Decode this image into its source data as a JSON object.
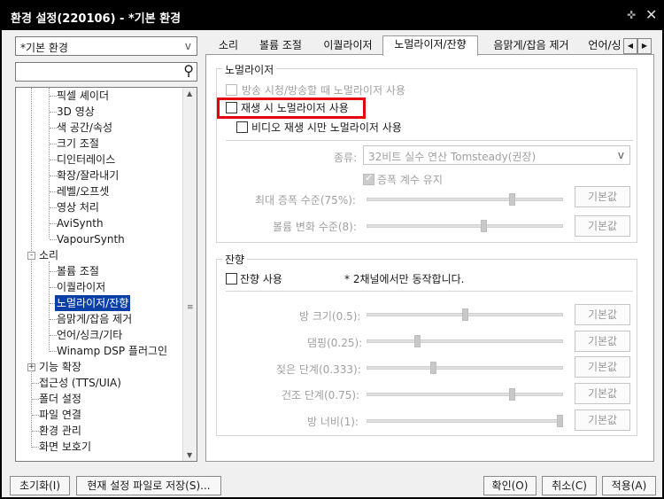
{
  "window": {
    "title": "환경 설정(220106) - *기본 환경",
    "pin_icon": "pin-icon",
    "close_icon": "close-icon"
  },
  "preset": {
    "value": "*기본 환경",
    "arrow": "v"
  },
  "search": {
    "value": "",
    "icon": "search-icon"
  },
  "tree": {
    "items": [
      {
        "label": "픽셀 셰이더"
      },
      {
        "label": "3D 영상"
      },
      {
        "label": "색 공간/속성"
      },
      {
        "label": "크기 조절"
      },
      {
        "label": "디인터레이스"
      },
      {
        "label": "확장/잘라내기"
      },
      {
        "label": "레벨/오프셋"
      },
      {
        "label": "영상 처리"
      },
      {
        "label": "AviSynth"
      },
      {
        "label": "VapourSynth"
      },
      {
        "label": "소리"
      },
      {
        "label": "볼륨 조절"
      },
      {
        "label": "이퀄라이저"
      },
      {
        "label": "노멀라이저/잔향"
      },
      {
        "label": "음맑게/잡음 제거"
      },
      {
        "label": "언어/싱크/기타"
      },
      {
        "label": "Winamp DSP 플러그인"
      },
      {
        "label": "기능 확장"
      },
      {
        "label": "접근성 (TTS/UIA)"
      },
      {
        "label": "폴더 설정"
      },
      {
        "label": "파일 연결"
      },
      {
        "label": "환경 관리"
      },
      {
        "label": "화면 보호기"
      }
    ],
    "expander_minus": "-",
    "expander_plus": "+"
  },
  "tabs": [
    {
      "label": "소리"
    },
    {
      "label": "볼륨 조절"
    },
    {
      "label": "이퀄라이저"
    },
    {
      "label": "노멀라이저/잔향"
    },
    {
      "label": "음맑게/잡음 제거"
    },
    {
      "label": "언어/싱"
    }
  ],
  "tab_nav": {
    "prev": "◀",
    "next": "▶"
  },
  "normalizer": {
    "title": "노멀라이저",
    "opt_broadcast": "방송 시청/방송할 때 노멀라이저 사용",
    "opt_playback": "재생 시 노멀라이저 사용",
    "opt_video": "비디오 재생 시만 노멀라이저 사용",
    "type_label": "종류:",
    "type_value": "32비트 실수 연산 Tomsteady(권장)",
    "type_arrow": "v",
    "keep_gain": "증폭 계수 유지",
    "max_gain_label": "최대 증폭 수준(75%):",
    "max_gain_value": 0.75,
    "volume_change_label": "볼륨 변화 수준(8):",
    "volume_change_value": 0.6,
    "default_label": "기본값"
  },
  "reverb": {
    "title": "잔향",
    "use_label": "잔향 사용",
    "note": "* 2채널에서만 동작합니다.",
    "params": [
      {
        "label": "방 크기(0.5):",
        "value": 0.5
      },
      {
        "label": "댐핑(0.25):",
        "value": 0.25
      },
      {
        "label": "젖은 단계(0.333):",
        "value": 0.333
      },
      {
        "label": "건조 단계(0.75):",
        "value": 0.75
      },
      {
        "label": "방 너비(1):",
        "value": 1.0
      }
    ],
    "default_label": "기본값"
  },
  "bottom": {
    "reset": "초기화(I)",
    "save_file": "현재 설정 파일로 저장(S)...",
    "ok": "확인(O)",
    "cancel": "취소(C)",
    "apply": "적용(A)"
  }
}
